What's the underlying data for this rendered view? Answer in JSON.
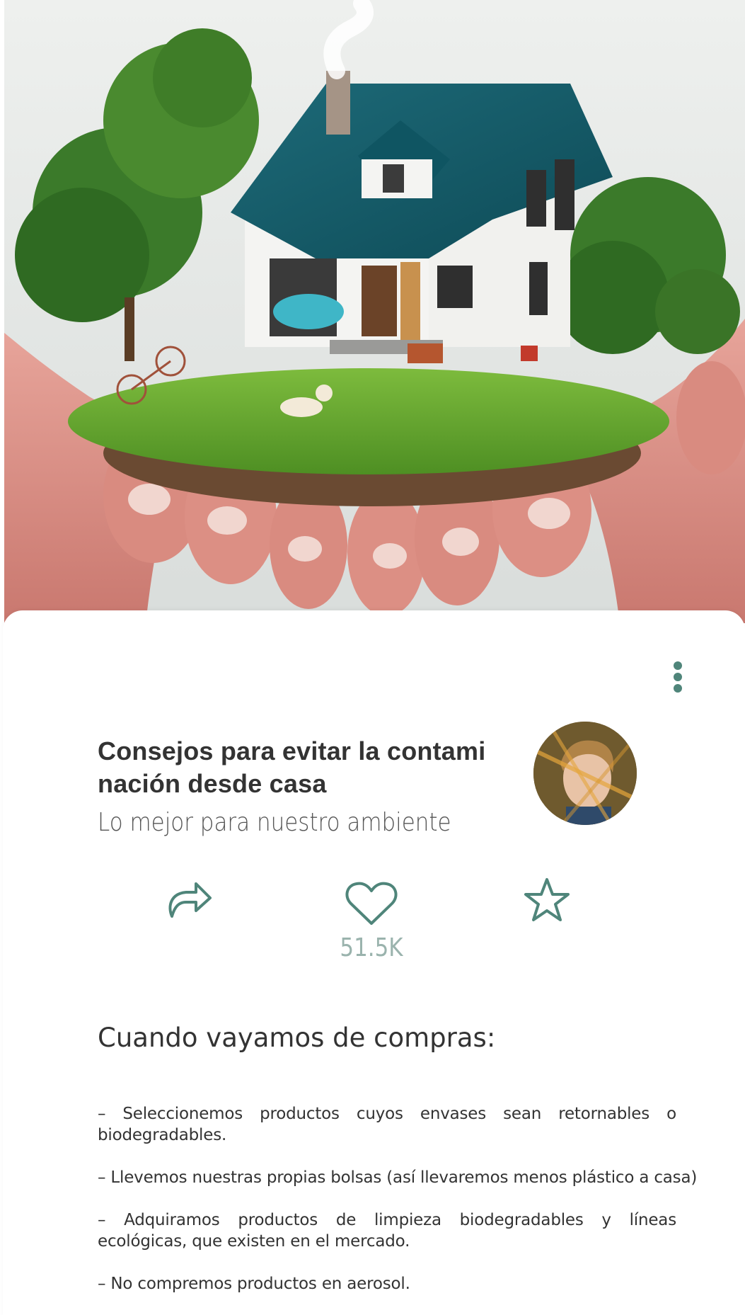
{
  "hero": {
    "image": "house-in-hands-photo"
  },
  "menu": {
    "icon": "more-vertical-icon"
  },
  "article": {
    "title_line1": "Consejos para evitar la contami",
    "title_line2": "nación desde casa",
    "subtitle": "Lo mejor para nuestro ambiente"
  },
  "author": {
    "avatar": "author-avatar"
  },
  "actions": {
    "share_icon": "share-icon",
    "like_icon": "heart-icon",
    "like_count": "51.5K",
    "favorite_icon": "star-icon",
    "accent_color": "#4f857a"
  },
  "content": {
    "heading": "Cuando vayamos de compras:",
    "tips": [
      "– Seleccionemos productos cuyos envases sean retornables o biodegradables.",
      "– Llevemos nuestras propias bolsas (así llevaremos menos plástico a casa)",
      "– Adquiramos productos de limpieza biodegradables y líneas ecológicas, que existen en el mercado.",
      "– No compremos productos en aerosol."
    ]
  }
}
